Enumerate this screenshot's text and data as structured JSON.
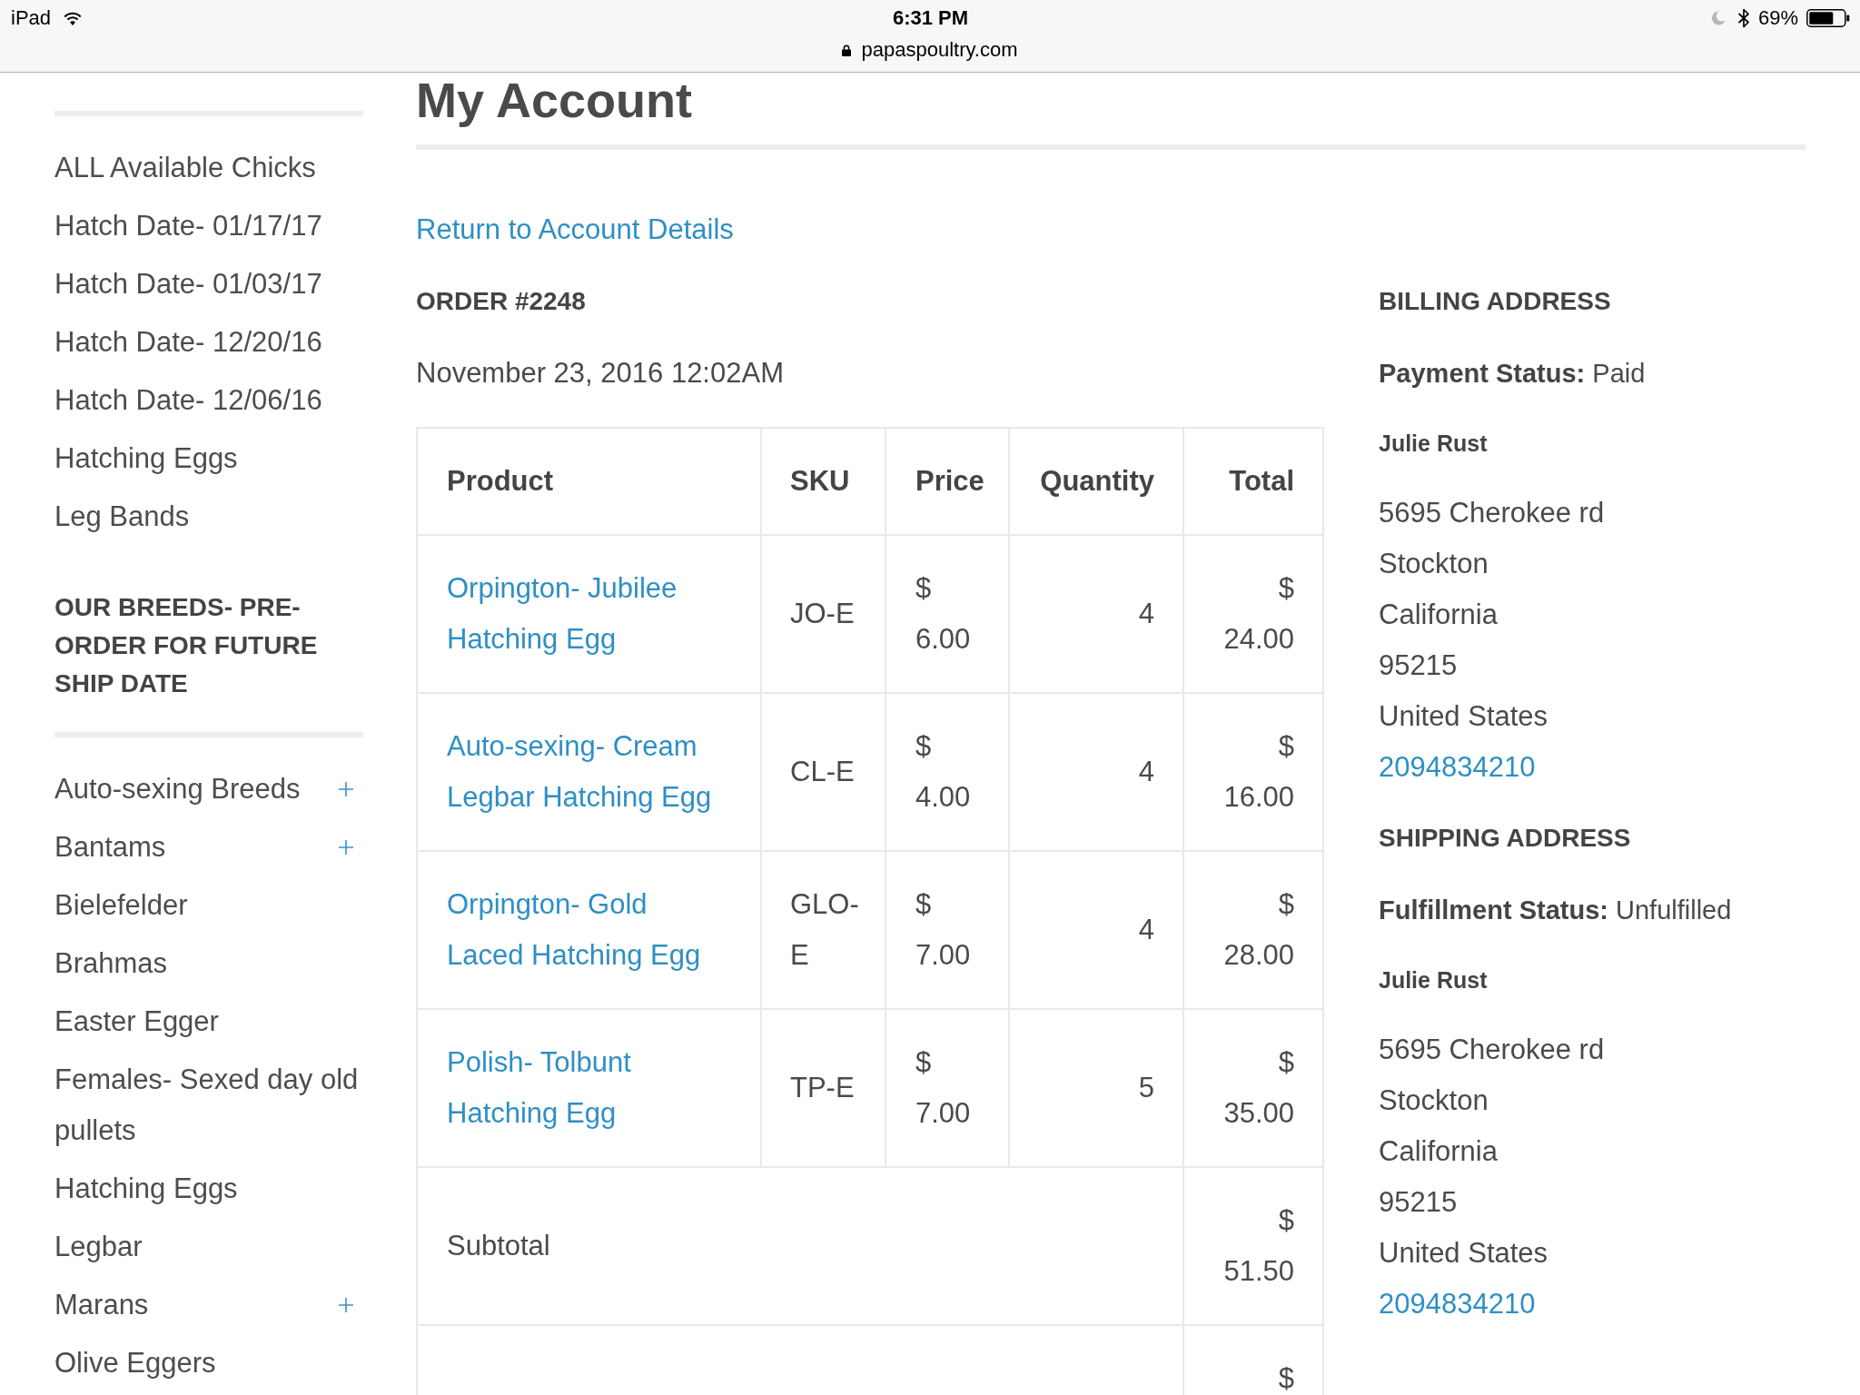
{
  "status_bar": {
    "device": "iPad",
    "time": "6:31 PM",
    "url": "papaspoultry.com",
    "battery": "69%"
  },
  "sidebar": {
    "groups": [
      {
        "items": [
          {
            "label": "ALL Available Chicks",
            "has_submenu": false
          },
          {
            "label": "Hatch Date- 01/17/17",
            "has_submenu": false
          },
          {
            "label": "Hatch Date- 01/03/17",
            "has_submenu": false
          },
          {
            "label": "Hatch Date- 12/20/16",
            "has_submenu": false
          },
          {
            "label": "Hatch Date- 12/06/16",
            "has_submenu": false
          },
          {
            "label": "Hatching Eggs",
            "has_submenu": false
          },
          {
            "label": "Leg Bands",
            "has_submenu": false
          }
        ]
      },
      {
        "heading": "OUR BREEDS- PRE-ORDER FOR FUTURE SHIP DATE",
        "items": [
          {
            "label": "Auto-sexing Breeds",
            "has_submenu": true
          },
          {
            "label": "Bantams",
            "has_submenu": true
          },
          {
            "label": "Bielefelder",
            "has_submenu": false
          },
          {
            "label": "Brahmas",
            "has_submenu": false
          },
          {
            "label": "Easter Egger",
            "has_submenu": false
          },
          {
            "label": "Females- Sexed day old pullets",
            "has_submenu": false
          },
          {
            "label": "Hatching Eggs",
            "has_submenu": false
          },
          {
            "label": "Legbar",
            "has_submenu": false
          },
          {
            "label": "Marans",
            "has_submenu": true
          },
          {
            "label": "Olive Eggers",
            "has_submenu": false
          }
        ]
      }
    ]
  },
  "page": {
    "title": "My Account",
    "back_link": "Return to Account Details"
  },
  "order": {
    "number": "ORDER #2248",
    "date": "November 23, 2016 12:02AM",
    "table": {
      "columns": [
        "Product",
        "SKU",
        "Price",
        "Quantity",
        "Total"
      ],
      "rows": [
        {
          "kind": "item",
          "product": "Orpington- Jubilee Hatching Egg",
          "sku": "JO-E",
          "price": "$ 6.00",
          "quantity": "4",
          "total": "$ 24.00"
        },
        {
          "kind": "item",
          "product": "Auto-sexing- Cream Legbar Hatching Egg",
          "sku": "CL-E",
          "price": "$ 4.00",
          "quantity": "4",
          "total": "$ 16.00"
        },
        {
          "kind": "item",
          "product": "Orpington- Gold Laced Hatching Egg",
          "sku": "GLO-E",
          "price": "$ 7.00",
          "quantity": "4",
          "total": "$ 28.00"
        },
        {
          "kind": "item",
          "product": "Polish- Tolbunt Hatching Egg",
          "sku": "TP-E",
          "price": "$ 7.00",
          "quantity": "5",
          "total": "$ 35.00"
        },
        {
          "kind": "summary",
          "label": "Subtotal",
          "total": "$ 51.50"
        },
        {
          "kind": "summary",
          "total": "$"
        }
      ]
    }
  },
  "addresses": [
    {
      "heading": "BILLING ADDRESS",
      "status": "**Payment Status:** Paid",
      "name": "Julie Rust",
      "lines": [
        "5695 Cherokee rd",
        "Stockton",
        "California",
        "95215",
        "United States"
      ],
      "phone": "2094834210"
    },
    {
      "heading": "SHIPPING ADDRESS",
      "status": "**Fulfillment Status:** Unfulfilled",
      "name": "Julie Rust",
      "lines": [
        "5695 Cherokee rd",
        "Stockton",
        "California",
        "95215",
        "United States"
      ],
      "phone": "2094834210"
    }
  ]
}
